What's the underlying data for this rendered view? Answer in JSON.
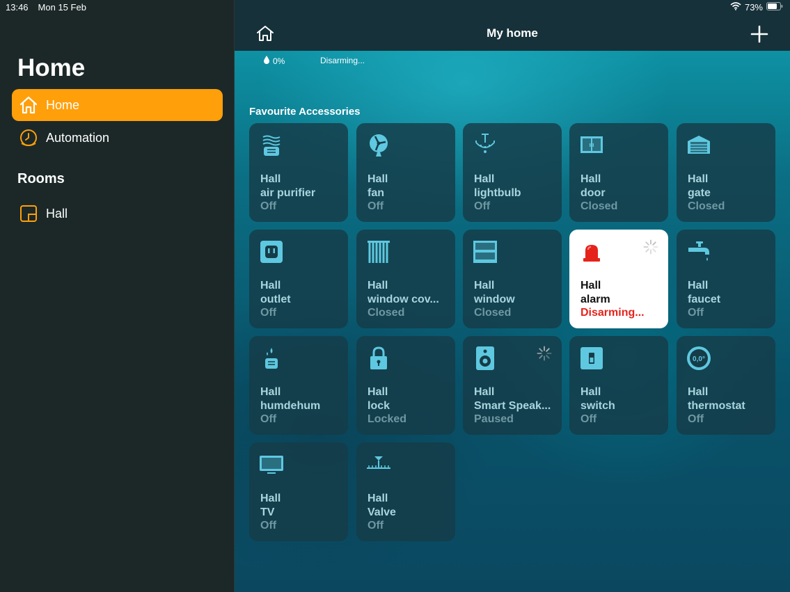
{
  "status": {
    "time": "13:46",
    "date": "Mon 15 Feb",
    "battery": "73%"
  },
  "sidebar": {
    "title": "Home",
    "items": [
      {
        "label": "Home",
        "icon": "house-icon",
        "active": true
      },
      {
        "label": "Automation",
        "icon": "clock-icon",
        "active": false
      }
    ],
    "rooms_title": "Rooms",
    "rooms": [
      {
        "label": "Hall",
        "icon": "room-icon"
      }
    ]
  },
  "header": {
    "title": "My home"
  },
  "summary": {
    "humidity": "0%",
    "alarm": "Disarming..."
  },
  "section": "Favourite Accessories",
  "tiles": [
    {
      "room": "Hall",
      "name": "air purifier",
      "state": "Off",
      "icon": "air-purifier-icon"
    },
    {
      "room": "Hall",
      "name": "fan",
      "state": "Off",
      "icon": "fan-icon"
    },
    {
      "room": "Hall",
      "name": "lightbulb",
      "state": "Off",
      "icon": "chandelier-icon"
    },
    {
      "room": "Hall",
      "name": "door",
      "state": "Closed",
      "icon": "door-icon"
    },
    {
      "room": "Hall",
      "name": "gate",
      "state": "Closed",
      "icon": "garage-gate-icon"
    },
    {
      "room": "Hall",
      "name": "outlet",
      "state": "Off",
      "icon": "outlet-icon"
    },
    {
      "room": "Hall",
      "name": "window cov...",
      "state": "Closed",
      "icon": "blinds-icon"
    },
    {
      "room": "Hall",
      "name": "window",
      "state": "Closed",
      "icon": "window-icon"
    },
    {
      "room": "Hall",
      "name": "alarm",
      "state": "Disarming...",
      "icon": "alarm-siren-icon"
    },
    {
      "room": "Hall",
      "name": "faucet",
      "state": "Off",
      "icon": "faucet-icon"
    },
    {
      "room": "Hall",
      "name": "humdehum",
      "state": "Off",
      "icon": "humidifier-icon"
    },
    {
      "room": "Hall",
      "name": "lock",
      "state": "Locked",
      "icon": "lock-icon"
    },
    {
      "room": "Hall",
      "name": "Smart Speak...",
      "state": "Paused",
      "icon": "speaker-icon"
    },
    {
      "room": "Hall",
      "name": "switch",
      "state": "Off",
      "icon": "switch-icon"
    },
    {
      "room": "Hall",
      "name": "thermostat",
      "state": "Off",
      "icon": "thermostat-icon",
      "icon_text": "0,0°"
    },
    {
      "room": "Hall",
      "name": "TV",
      "state": "Off",
      "icon": "tv-icon"
    },
    {
      "room": "Hall",
      "name": "Valve",
      "state": "Off",
      "icon": "valve-icon"
    }
  ],
  "colors": {
    "accent": "#ff9f0a",
    "tile_icon": "#5ec8e0",
    "alarm_red": "#e5231b"
  }
}
